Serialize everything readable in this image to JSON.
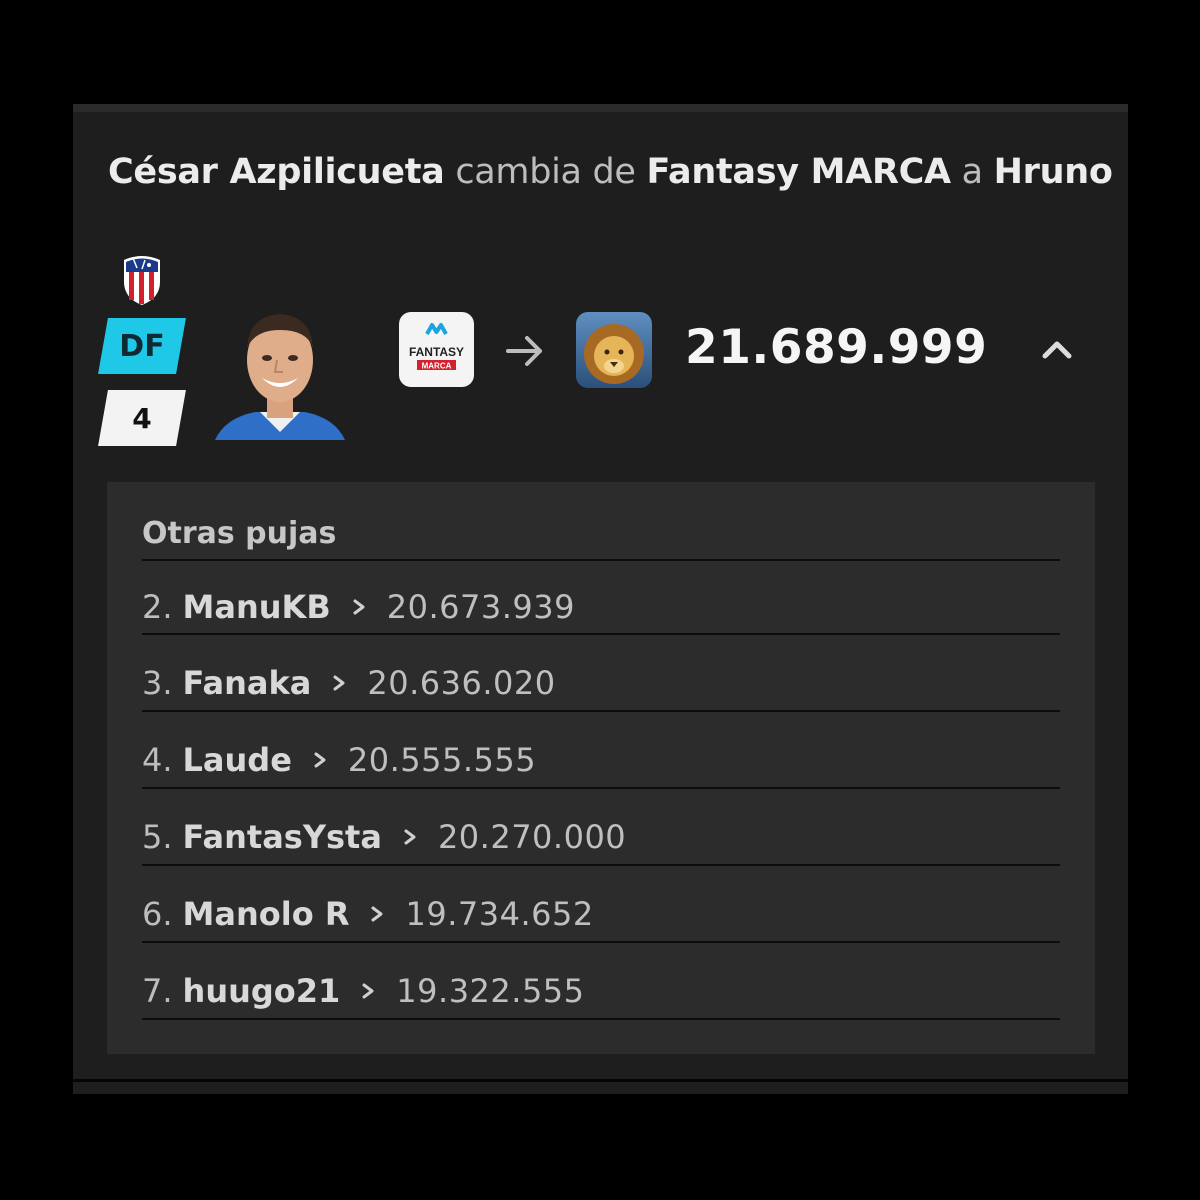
{
  "headline": {
    "player": "César Azpilicueta",
    "verb": "cambia de",
    "from": "Fantasy MARCA",
    "connector": "a",
    "to": "Hruno"
  },
  "player": {
    "position": "DF",
    "number": "4",
    "club_crest_icon": "atletico-madrid-crest-icon"
  },
  "transfer": {
    "from_logo": "fantasy-marca-logo",
    "from_logo_text": "FANTASY MARCA",
    "to_logo": "lion-avatar",
    "price": "21.689.999"
  },
  "other_bids": {
    "title": "Otras pujas",
    "rows": [
      {
        "rank": "2.",
        "name": "ManuKB",
        "amount": "20.673.939"
      },
      {
        "rank": "3.",
        "name": "Fanaka",
        "amount": "20.636.020"
      },
      {
        "rank": "4.",
        "name": "Laude",
        "amount": "20.555.555"
      },
      {
        "rank": "5.",
        "name": "FantasYsta",
        "amount": "20.270.000"
      },
      {
        "rank": "6.",
        "name": "Manolo R",
        "amount": "19.734.652"
      },
      {
        "rank": "7.",
        "name": "huugo21",
        "amount": "19.322.555"
      }
    ]
  },
  "colors": {
    "background": "#000000",
    "card": "#1e1e1e",
    "panel": "#2c2c2c",
    "position_badge": "#1ec8e6",
    "number_badge": "#f3f3f3"
  }
}
